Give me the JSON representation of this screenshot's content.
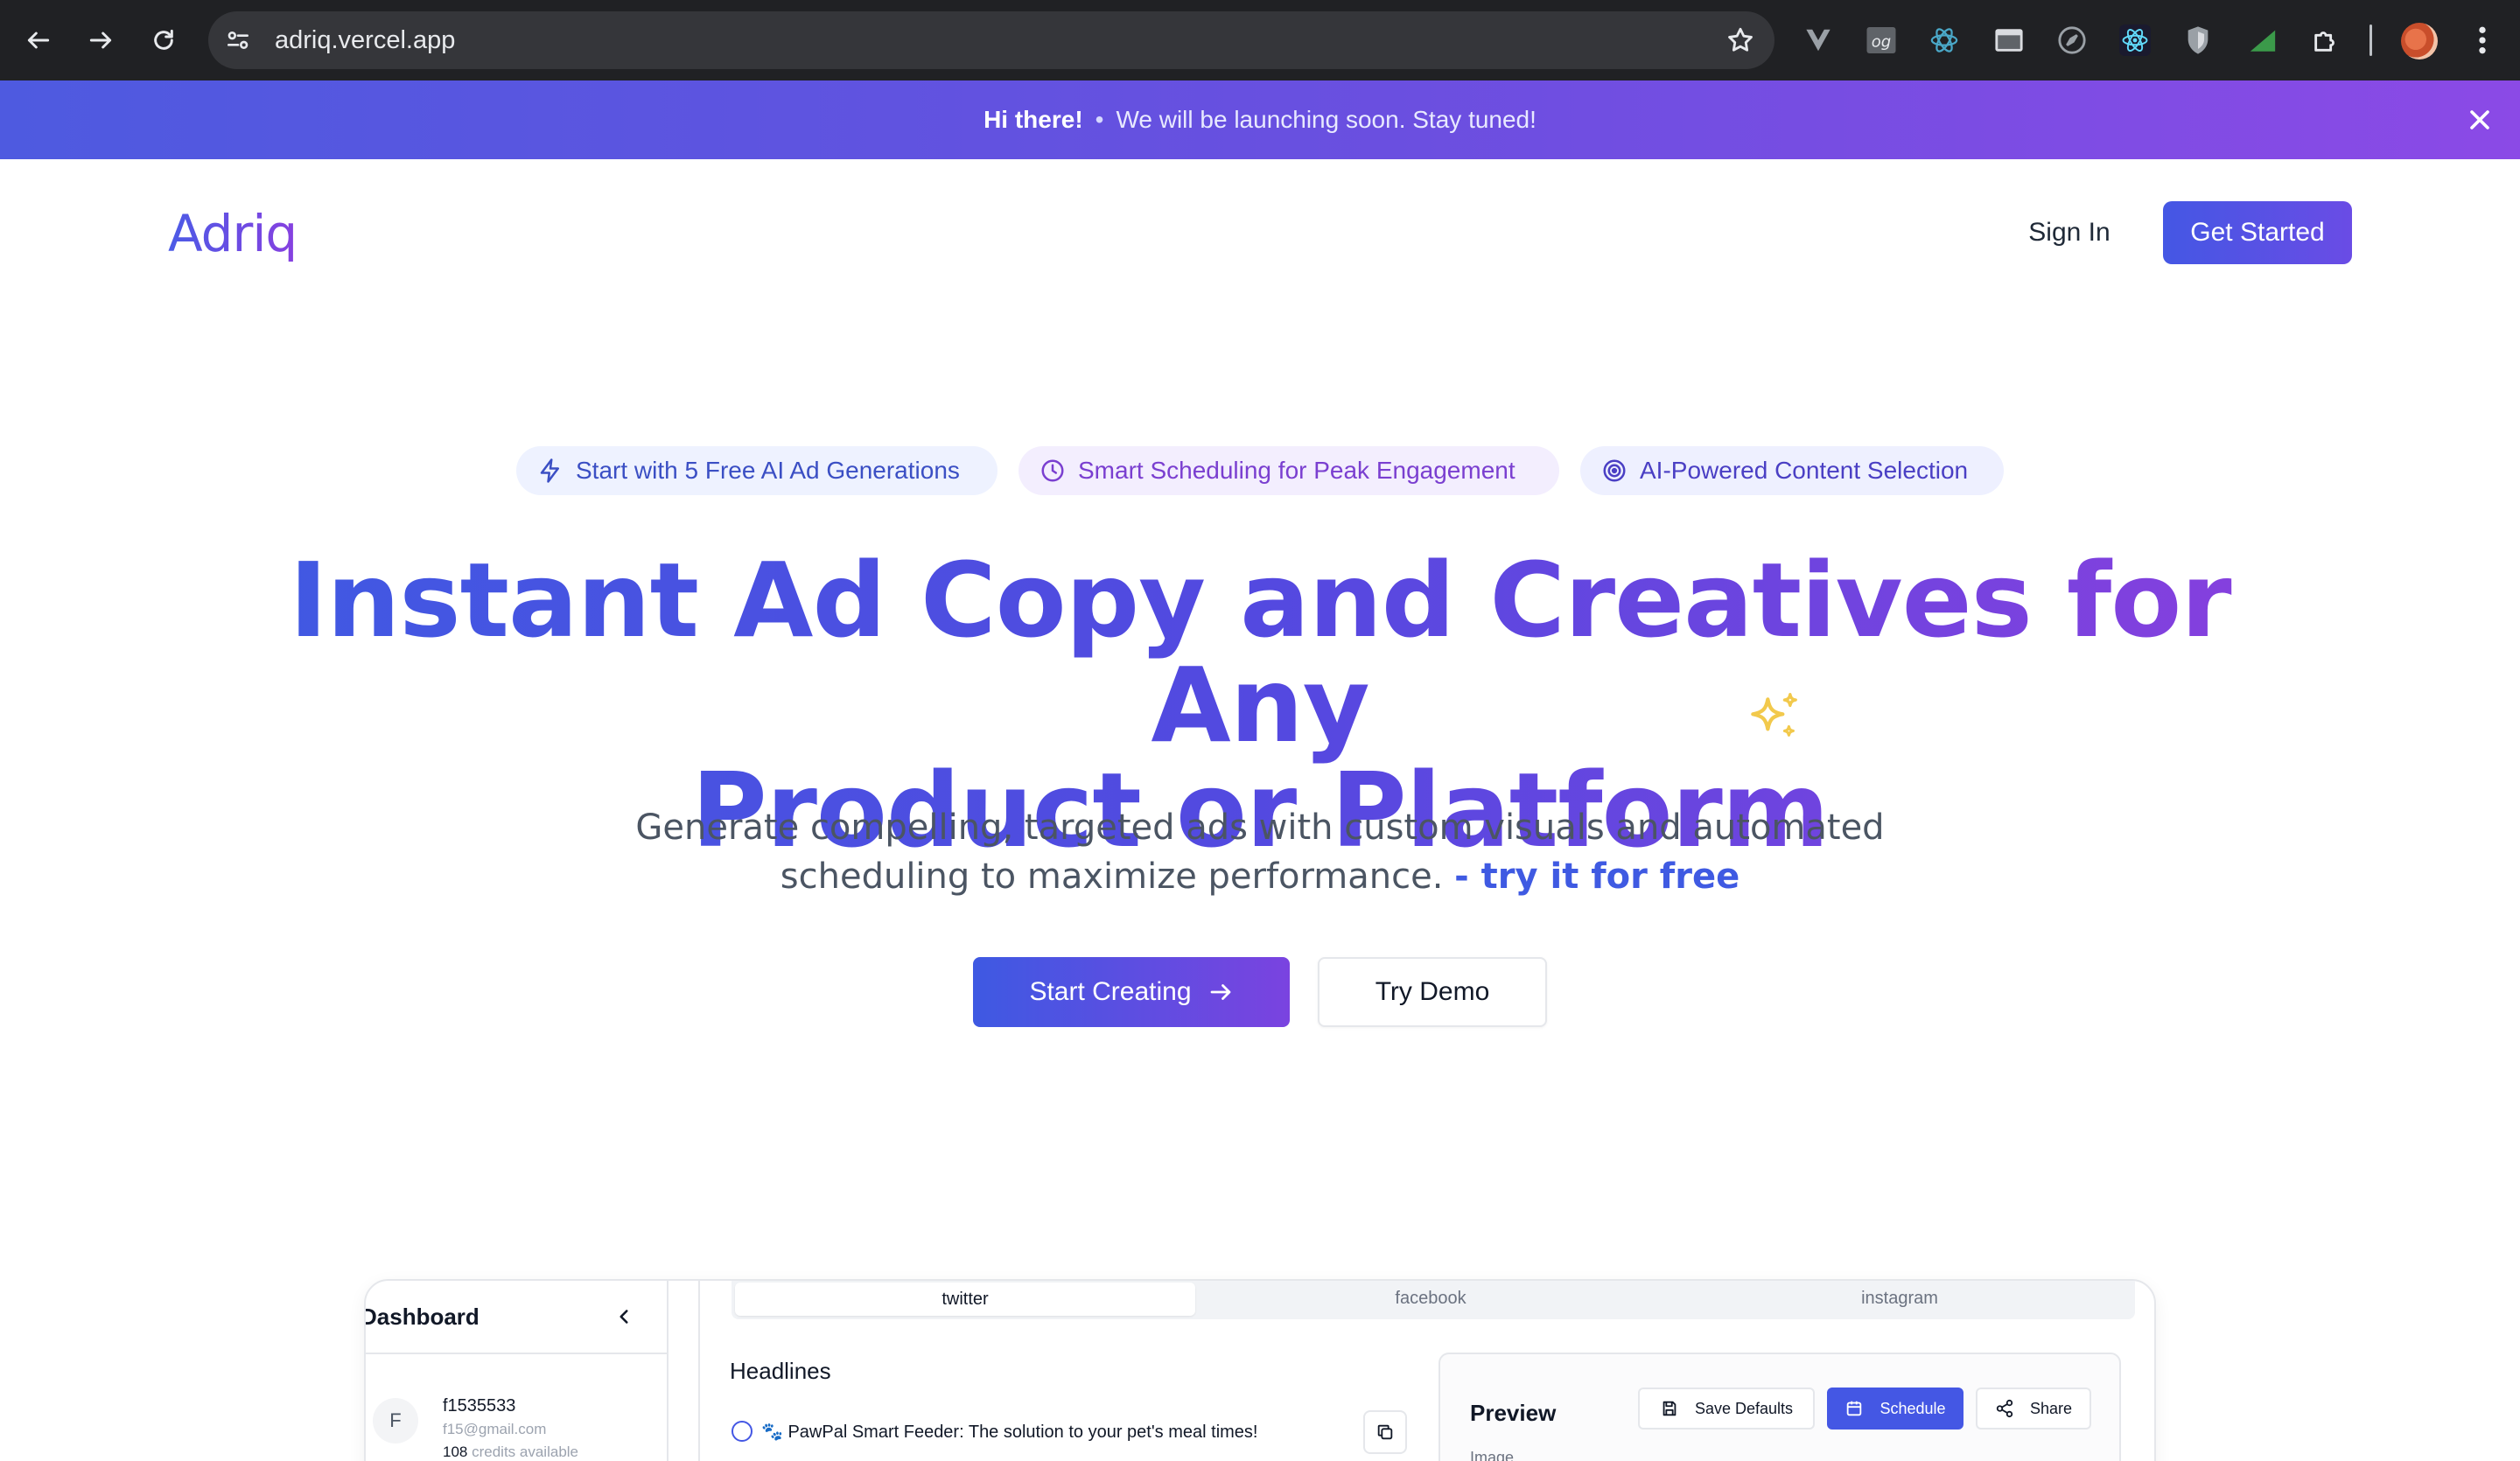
{
  "browser": {
    "url": "adriq.vercel.app",
    "extensions": [
      "vue-devtools-icon",
      "og-icon",
      "react-devtools-icon",
      "window-icon",
      "compass-icon",
      "react-icon",
      "shield-icon",
      "signal-icon",
      "puzzle-icon"
    ]
  },
  "banner": {
    "greeting": "Hi there!",
    "separator": "•",
    "message": "We will be launching soon. Stay tuned!"
  },
  "header": {
    "logo": "Adriq",
    "sign_in": "Sign In",
    "get_started": "Get Started"
  },
  "pills": [
    {
      "label": "Start with 5 Free AI Ad Generations",
      "icon": "lightning-icon"
    },
    {
      "label": "Smart Scheduling for Peak Engagement",
      "icon": "clock-icon"
    },
    {
      "label": "AI-Powered Content Selection",
      "icon": "target-icon"
    }
  ],
  "hero": {
    "title_line1": "Instant Ad Copy and Creatives for Any",
    "title_line2": "Product or Platform",
    "subtitle_line1": "Generate compelling, targeted ads with custom visuals and automated",
    "subtitle_line2": "scheduling to maximize performance.",
    "subtitle_highlight": "- try it for free",
    "start_creating": "Start Creating",
    "try_demo": "Try Demo"
  },
  "app_preview": {
    "sidebar": {
      "title": "Dashboard",
      "avatar_initial": "F",
      "username": "f1535533",
      "email": "f15@gmail.com",
      "credits_count": "108",
      "credits_label": "credits available"
    },
    "tabs": [
      "twitter",
      "facebook",
      "instagram"
    ],
    "active_tab": "twitter",
    "headlines_title": "Headlines",
    "headline_item": "🐾 PawPal Smart Feeder: The solution to your pet's meal times!",
    "preview": {
      "title": "Preview",
      "save_defaults": "Save Defaults",
      "schedule": "Schedule",
      "share": "Share",
      "image_label": "Image"
    }
  },
  "colors": {
    "brand_blue": "#4457e4",
    "brand_purple": "#8a3fde",
    "banner_start": "#4e5ae0",
    "banner_end": "#8b4ae6",
    "sparkle": "#f2c94c"
  }
}
